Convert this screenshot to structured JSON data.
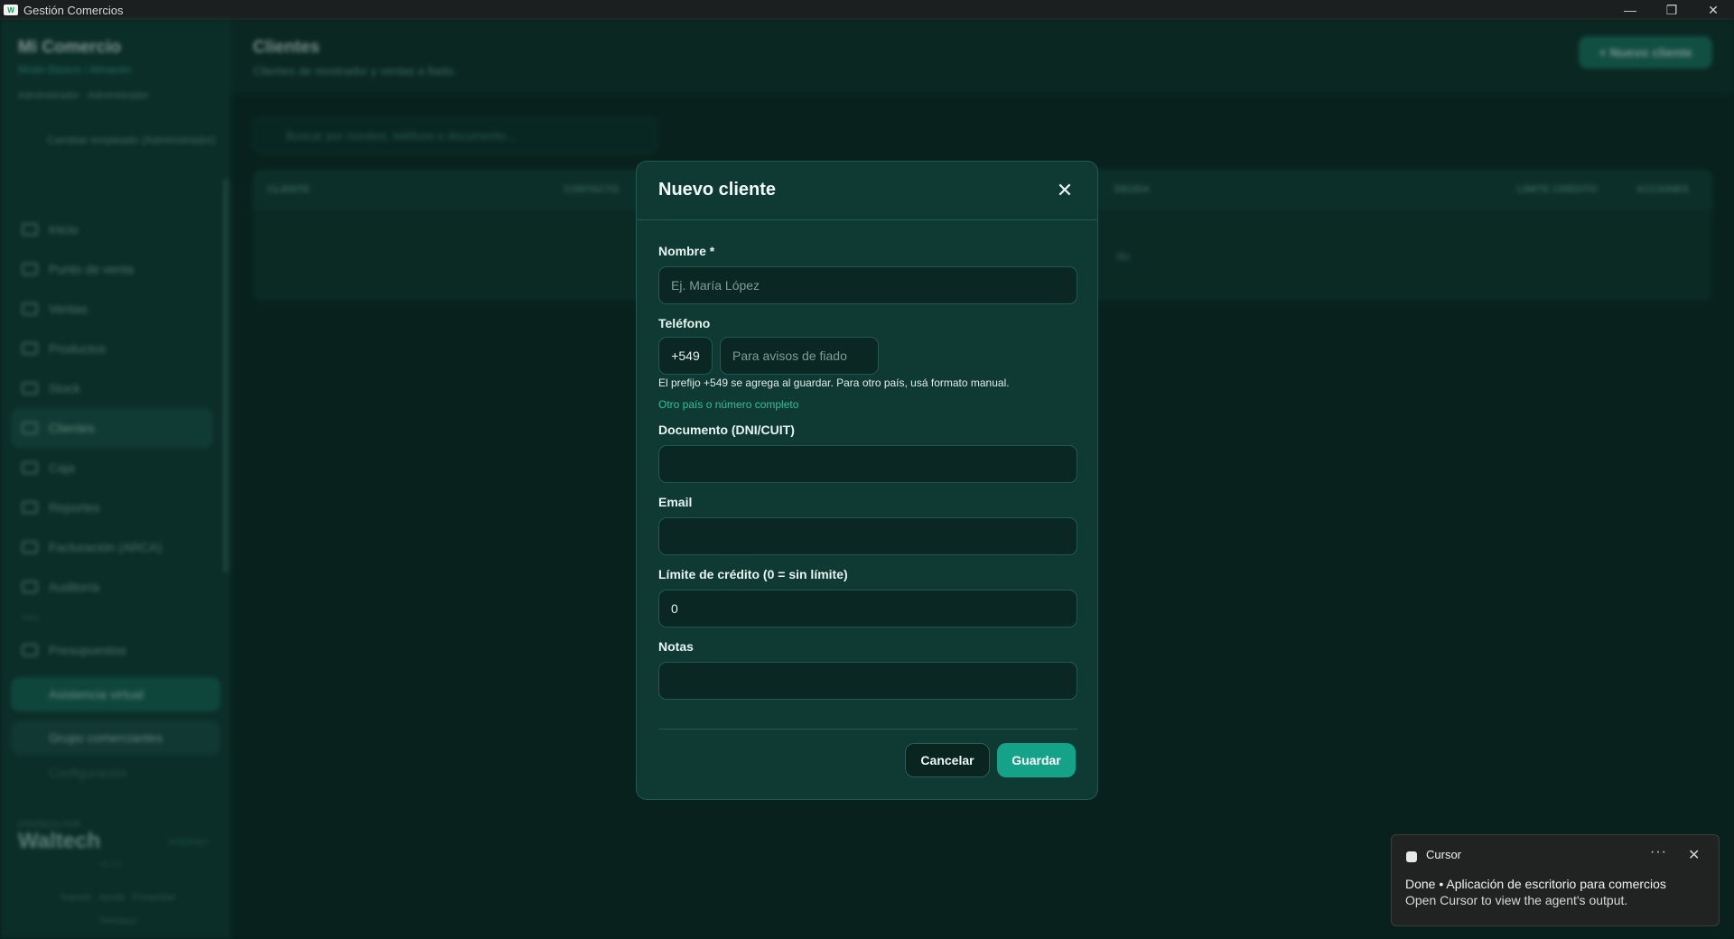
{
  "window": {
    "title": "Gestión Comercios",
    "minimize": "—",
    "restore": "❐",
    "close": "✕"
  },
  "sidebar": {
    "brand": "Mi Comercio",
    "subtitle": "Modo Básico / Almacén",
    "role": "Administrador · Administrador",
    "switch_employee": "Cambiar empleado (Administrador)",
    "items": [
      {
        "label": "Inicio",
        "icon": "home-icon"
      },
      {
        "label": "Punto de venta",
        "icon": "cart-icon"
      },
      {
        "label": "Ventas",
        "icon": "receipt-icon"
      },
      {
        "label": "Productos",
        "icon": "box-icon"
      },
      {
        "label": "Stock",
        "icon": "stock-icon"
      },
      {
        "label": "Clientes",
        "icon": "users-icon"
      },
      {
        "label": "Caja",
        "icon": "cash-icon"
      },
      {
        "label": "Reportes",
        "icon": "chart-icon"
      },
      {
        "label": "Facturación (ARCA)",
        "icon": "invoice-icon"
      },
      {
        "label": "Auditoría",
        "icon": "audit-icon"
      }
    ],
    "section_label": "PRO",
    "pro_items": [
      {
        "label": "Presupuestos",
        "icon": "document-icon"
      }
    ],
    "virtual_assistant": "Asistencia virtual",
    "merchants_group": "Grupo comerciantes",
    "settings": "Configuración",
    "designed_by": "DISEÑADO POR",
    "maker": "Waltech",
    "internet_badge": "INTERNET",
    "version": "v1.1.0",
    "footer_links": [
      "Soporte",
      "Ayuda",
      "Privacidad",
      "Términos"
    ]
  },
  "main": {
    "title": "Clientes",
    "subtitle": "Clientes de mostrador y ventas a fiado.",
    "new_button": "+ Nuevo cliente",
    "search_placeholder": "Buscar por nombre, teléfono o documento...",
    "columns": [
      "CLIENTE",
      "CONTACTO",
      "DEUDA",
      "LÍMITE CRÉDITO",
      "ACCIONES"
    ],
    "empty_text": "do."
  },
  "modal": {
    "title": "Nuevo cliente",
    "close_icon": "close-icon",
    "name_label": "Nombre *",
    "name_placeholder": "Ej. María López",
    "name_value": "",
    "phone_label": "Teléfono",
    "phone_prefix": "+549",
    "phone_placeholder": "Para avisos de fiado",
    "phone_value": "",
    "phone_hint": "El prefijo +549 se agrega al guardar. Para otro país, usá formato manual.",
    "phone_link": "Otro país o número completo",
    "doc_label": "Documento (DNI/CUIT)",
    "doc_value": "",
    "email_label": "Email",
    "email_value": "",
    "credit_label": "Límite de crédito (0 = sin límite)",
    "credit_value": "0",
    "notes_label": "Notas",
    "notes_value": "",
    "cancel": "Cancelar",
    "save": "Guardar"
  },
  "toast": {
    "app": "Cursor",
    "more": "···",
    "close": "✕",
    "line1": "Done • Aplicación de escritorio para comercios",
    "line2": "Open Cursor to view the agent's output."
  },
  "colors": {
    "accent": "#14a389",
    "sidebar": "#14453d",
    "modal": "#0f3a33"
  }
}
